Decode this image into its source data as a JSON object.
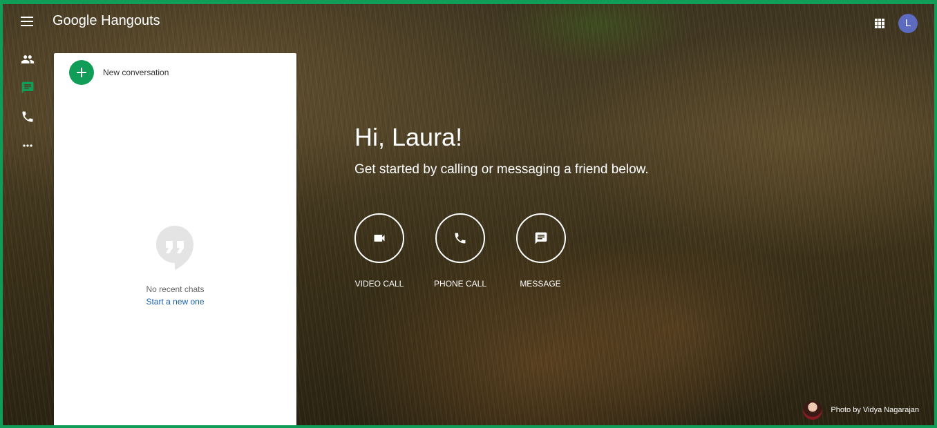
{
  "topbar": {
    "brand_google": "Google",
    "brand_product": "Hangouts",
    "avatar_initial": "L",
    "menu_icon": "hamburger-menu-icon",
    "apps_icon": "apps-grid-icon"
  },
  "rail": {
    "items": [
      {
        "icon": "people-icon",
        "active": false
      },
      {
        "icon": "chat-icon",
        "active": true
      },
      {
        "icon": "phone-icon",
        "active": false
      },
      {
        "icon": "more-horizontal-icon",
        "active": false
      }
    ]
  },
  "panel": {
    "new_conversation": "New conversation",
    "empty_text": "No recent chats",
    "empty_link": "Start a new one"
  },
  "main": {
    "greeting": "Hi, Laura!",
    "subtitle": "Get started by calling or messaging a friend below.",
    "actions": [
      {
        "label": "VIDEO CALL",
        "icon": "video-camera-icon"
      },
      {
        "label": "PHONE CALL",
        "icon": "phone-icon"
      },
      {
        "label": "MESSAGE",
        "icon": "message-icon"
      }
    ]
  },
  "credit": {
    "text": "Photo by Vidya Nagarajan"
  },
  "colors": {
    "accent": "#0f9d58",
    "avatar": "#5c6bc0",
    "link": "#1a5fb4"
  }
}
